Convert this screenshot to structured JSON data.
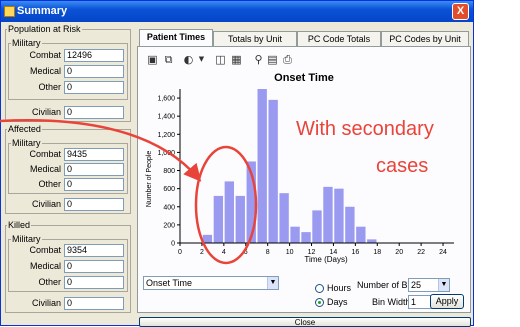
{
  "window": {
    "title": "Summary",
    "close_glyph": "X"
  },
  "population": {
    "group_label": "Population at Risk",
    "military_label": "Military",
    "combat_label": "Combat",
    "combat_value": "12496",
    "medical_label": "Medical",
    "medical_value": "0",
    "other_label": "Other",
    "other_value": "0",
    "civilian_label": "Civilian",
    "civilian_value": "0"
  },
  "affected": {
    "group_label": "Affected",
    "military_label": "Military",
    "combat_label": "Combat",
    "combat_value": "9435",
    "medical_label": "Medical",
    "medical_value": "0",
    "other_label": "Other",
    "other_value": "0",
    "civilian_label": "Civilian",
    "civilian_value": "0"
  },
  "killed": {
    "group_label": "Killed",
    "military_label": "Military",
    "combat_label": "Combat",
    "combat_value": "9354",
    "medical_label": "Medical",
    "medical_value": "0",
    "other_label": "Other",
    "other_value": "0",
    "civilian_label": "Civilian",
    "civilian_value": "0"
  },
  "tabs": [
    "Patient Times",
    "Totals by Unit",
    "PC Code Totals",
    "PC Codes by Unit"
  ],
  "toolbar_icons": [
    "save-icon",
    "copy-icon",
    "palette-icon",
    "dropdown-icon",
    "chart-view-icon",
    "table-view-icon",
    "zoom-icon",
    "print-preview-icon",
    "print-icon"
  ],
  "chart_data": {
    "type": "bar",
    "title": "Onset Time",
    "xlabel": "Time (Days)",
    "ylabel": "Number of People",
    "x_ticks": [
      0,
      2,
      4,
      6,
      8,
      10,
      12,
      14,
      16,
      18,
      20,
      22,
      24
    ],
    "y_ticks": [
      0,
      200,
      400,
      600,
      800,
      1000,
      1200,
      1400,
      1600
    ],
    "xlim": [
      0,
      25
    ],
    "ylim": [
      0,
      1700
    ],
    "bin_starts": [
      2,
      3,
      4,
      5,
      6,
      7,
      8,
      9,
      10,
      11,
      12,
      13,
      14,
      15,
      16,
      17
    ],
    "values": [
      90,
      520,
      680,
      520,
      900,
      1700,
      1580,
      550,
      180,
      120,
      360,
      620,
      600,
      400,
      180,
      40
    ],
    "bar_color": "#9a9af0"
  },
  "controls": {
    "series_select": "Onset Time",
    "hours_label": "Hours",
    "days_label": "Days",
    "bins_label": "Number of Bins",
    "bins_value": "25",
    "width_label": "Bin Width",
    "width_value": "1",
    "apply_label": "Apply"
  },
  "close_label": "Close",
  "annotation": {
    "line1": "With secondary",
    "line2": "cases",
    "color": "#e8443a"
  }
}
